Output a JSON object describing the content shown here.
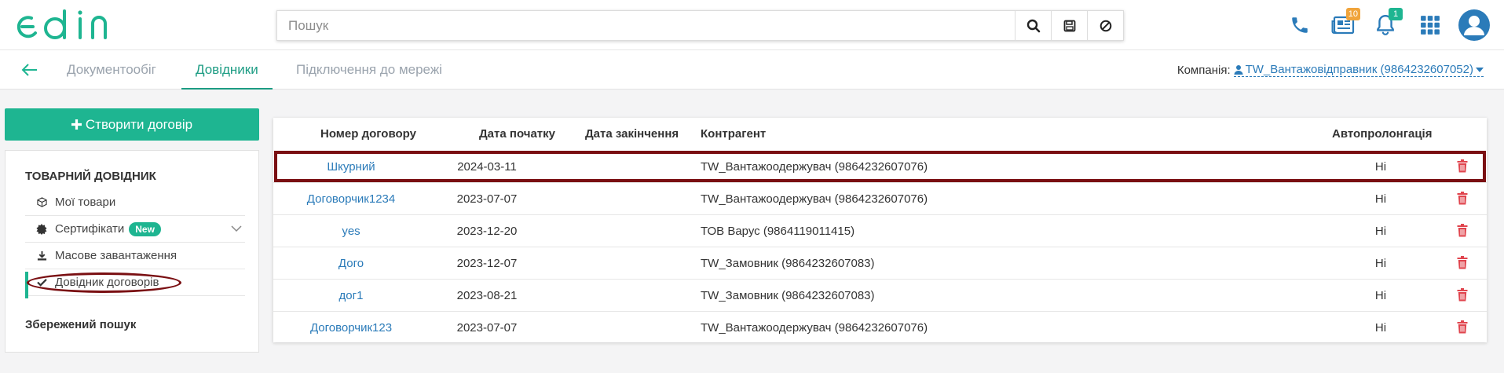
{
  "header": {
    "logo_text": "edin",
    "search_placeholder": "Пошук",
    "notif_badges": {
      "docs": "10",
      "bell": "1"
    },
    "icons": [
      "phone-icon",
      "news-icon",
      "bell-icon",
      "apps-grid-icon",
      "user-avatar-icon"
    ]
  },
  "tabs": {
    "items": [
      "Документообіг",
      "Довідники",
      "Підключення до мережі"
    ],
    "active": "Довідники",
    "company_label": "Компанія:",
    "company_value": "TW_Вантажовідправник (9864232607052)"
  },
  "sidebar": {
    "create_label": "Створити договір",
    "section_title": "ТОВАРНИЙ ДОВІДНИК",
    "items": [
      {
        "label": "Мої товари",
        "icon": "box-icon"
      },
      {
        "label": "Сертифікати",
        "icon": "cert-icon",
        "badge": "New"
      },
      {
        "label": "Масове завантаження",
        "icon": "download-icon"
      },
      {
        "label": "Довідник договорів",
        "icon": "check-icon"
      }
    ],
    "saved_search": "Збережений пошук"
  },
  "table": {
    "headers": [
      "Номер договору",
      "Дата початку",
      "Дата закінчення",
      "Контрагент",
      "Автопролонгація"
    ],
    "rows": [
      {
        "number": "Шкурний",
        "start": "2024-03-11",
        "end": "",
        "contractor": "TW_Вантажоодержувач (9864232607076)",
        "autoprolong": "Ні"
      },
      {
        "number": "Договорчик1234",
        "start": "2023-07-07",
        "end": "",
        "contractor": "TW_Вантажоодержувач (9864232607076)",
        "autoprolong": "Ні"
      },
      {
        "number": "yes",
        "start": "2023-12-20",
        "end": "",
        "contractor": "ТОВ Варус (9864119011415)",
        "autoprolong": "Ні"
      },
      {
        "number": "Дого",
        "start": "2023-12-07",
        "end": "",
        "contractor": "TW_Замовник (9864232607083)",
        "autoprolong": "Ні"
      },
      {
        "number": "дог1",
        "start": "2023-08-21",
        "end": "",
        "contractor": "TW_Замовник (9864232607083)",
        "autoprolong": "Ні"
      },
      {
        "number": "Договорчик123",
        "start": "2023-07-07",
        "end": "",
        "contractor": "TW_Вантажоодержувач (9864232607076)",
        "autoprolong": "Ні"
      }
    ]
  },
  "colors": {
    "brand": "#1eb591",
    "link": "#2b7bb9",
    "highlight": "#7a0f12",
    "danger": "#e0454e"
  }
}
